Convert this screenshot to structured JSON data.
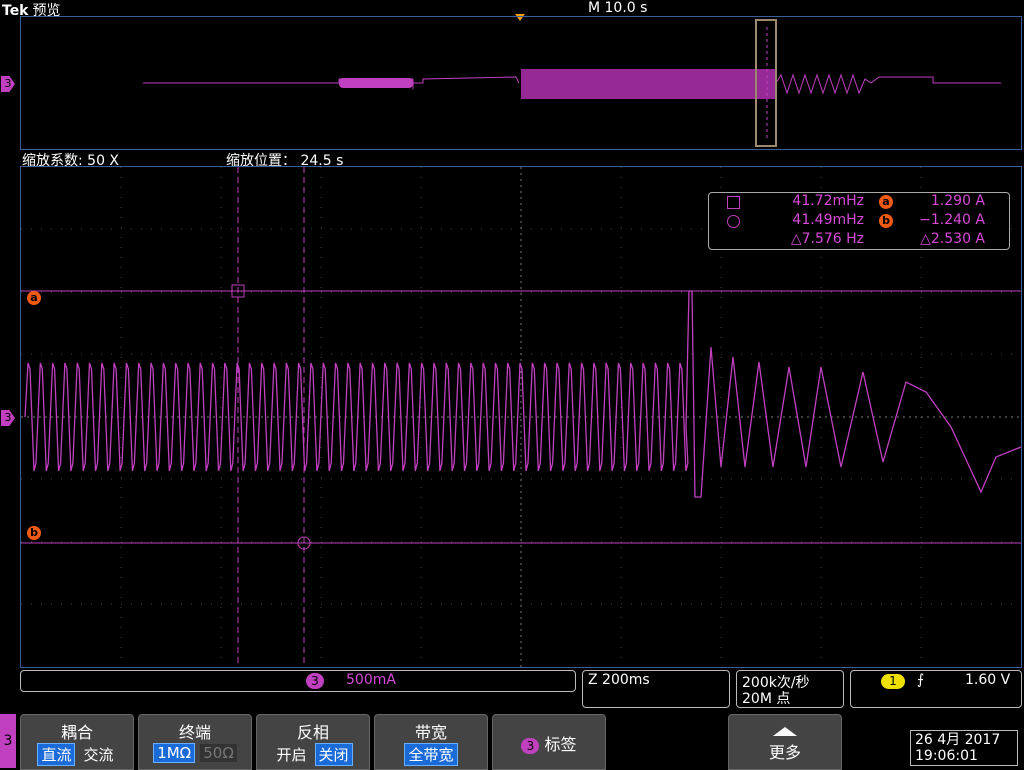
{
  "header": {
    "brand": "Tek",
    "brand_sub": "预览",
    "timebase": "M 10.0 s"
  },
  "channel": {
    "label": "3",
    "color": "#c040c0"
  },
  "zoom": {
    "factor_label": "缩放系数: 50 X",
    "position_label": "缩放位置：  24.5 s"
  },
  "cursors": {
    "row1": {
      "freq": "41.72mHz",
      "tag": "a",
      "value": "1.290 A"
    },
    "row2": {
      "freq": "41.49mHz",
      "tag": "b",
      "value": "−1.240 A"
    },
    "row3": {
      "delta_freq": "△7.576 Hz",
      "delta_value": "△2.530 A"
    }
  },
  "status": {
    "ch_scale": "500mA",
    "zoom_time": "Z 200ms",
    "sample_rate": "200k次/秒",
    "record_length": "20M 点",
    "trigger_ch": "1",
    "trigger_level": "1.60 V"
  },
  "menu": {
    "side_label": "3",
    "coupling": {
      "title": "耦合",
      "opt1": "直流",
      "opt2": "交流"
    },
    "termination": {
      "title": "终端",
      "opt1": "1MΩ",
      "opt2": "50Ω"
    },
    "invert": {
      "title": "反相",
      "opt1": "开启",
      "opt2": "关闭"
    },
    "bandwidth": {
      "title": "带宽",
      "opt1": "全带宽"
    },
    "label": {
      "ch": "3",
      "title": "标签"
    },
    "more": {
      "title": "更多"
    }
  },
  "datetime": {
    "date": "26 4月  2017",
    "time": "19:06:01"
  },
  "colors": {
    "trace": "#c040c0",
    "cursor_tag": "#f05a14",
    "grid_border": "#3a5f9a",
    "selected": "#1a6ad8"
  }
}
